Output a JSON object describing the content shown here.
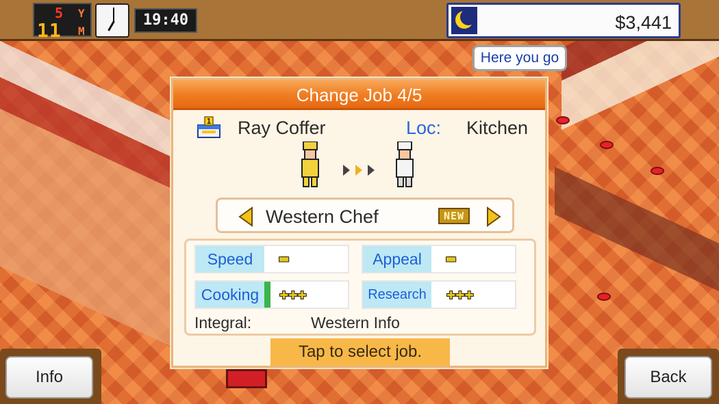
{
  "hud": {
    "year": "5",
    "year_unit": "Y",
    "month": "11",
    "month_unit": "M",
    "time": "19:40",
    "money": "$3,441",
    "clock_icon": "clock-icon",
    "time_of_day_icon": "moon-icon"
  },
  "bubble": {
    "text": "Here you go"
  },
  "dialog": {
    "title": "Change Job 4/5",
    "staff": {
      "rank": "1",
      "name": "Ray Coffer",
      "loc_label": "Loc:",
      "loc_value": "Kitchen"
    },
    "job": {
      "name": "Western Chef",
      "badge": "NEW"
    },
    "stats": [
      {
        "label": "Speed",
        "value": "▬",
        "bar": false
      },
      {
        "label": "Appeal",
        "value": "▬",
        "bar": false
      },
      {
        "label": "Cooking",
        "value": "✚✚✚",
        "bar": true
      },
      {
        "label": "Research",
        "value": "✚✚✚",
        "bar": false
      }
    ],
    "integral_label": "Integral:",
    "integral_value": "Western Info",
    "hint": "Tap to select job."
  },
  "buttons": {
    "info": "Info",
    "back": "Back"
  },
  "colors": {
    "title_orange": "#ef7c20",
    "loc_blue": "#2a66e0",
    "stat_label_bg": "#bde8f4",
    "hint_bg": "#f7b848"
  }
}
